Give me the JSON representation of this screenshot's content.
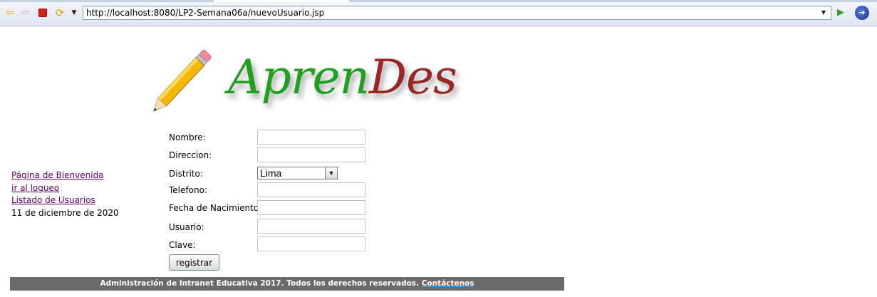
{
  "browser": {
    "url": "http://localhost:8080/LP2-Semana06a/nuevoUsuario.jsp",
    "icons": {
      "back": "back-arrow-icon",
      "forward": "forward-arrow-icon",
      "stop": "stop-icon",
      "refresh": "refresh-icon",
      "menu": "dropdown-icon",
      "go": "go-arrow-icon",
      "extension": "extension-icon"
    }
  },
  "logo": {
    "part1": "Apren",
    "part2": "Des",
    "colors": {
      "part1": "#1fa11f",
      "part2": "#9a2626"
    }
  },
  "sidebar": {
    "links": [
      {
        "label": "Página de Bienvenida"
      },
      {
        "label": "ir al logueo"
      },
      {
        "label": "Listado de Usuarios"
      }
    ],
    "date": "11 de diciembre de 2020"
  },
  "form": {
    "fields": {
      "nombre": {
        "label": "Nombre:",
        "value": ""
      },
      "direccion": {
        "label": "Direccion:",
        "value": ""
      },
      "distrito": {
        "label": "Distrito:",
        "selected": "Lima"
      },
      "telefono": {
        "label": "Telefono:",
        "value": ""
      },
      "fecha": {
        "label": "Fecha de Nacimiento:",
        "value": ""
      },
      "usuario": {
        "label": "Usuario:",
        "value": ""
      },
      "clave": {
        "label": "Clave:",
        "value": ""
      }
    },
    "submit_label": "registrar"
  },
  "footer": {
    "text": "Administración de Intranet Educativa 2017. Todos los derechos reservados.",
    "link": "Contáctenos",
    "background": "#6a6a6a"
  }
}
